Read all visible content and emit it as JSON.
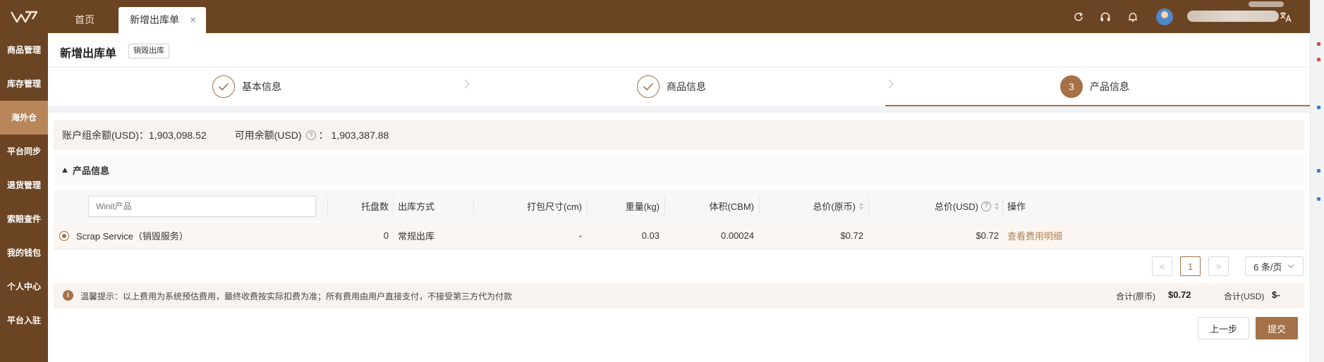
{
  "topbar": {
    "tabs": [
      {
        "label": "首页"
      },
      {
        "label": "新增出库单"
      }
    ],
    "close_glyph": "×",
    "icons": [
      "refresh-icon",
      "headset-icon",
      "bell-icon",
      "translate-icon"
    ],
    "colors": {
      "bar": "#6b4423",
      "accent": "#a47148"
    }
  },
  "sidebar": {
    "items": [
      {
        "label": "商品管理"
      },
      {
        "label": "库存管理"
      },
      {
        "label": "海外仓"
      },
      {
        "label": "平台同步"
      },
      {
        "label": "退货管理"
      },
      {
        "label": "索赔查件"
      },
      {
        "label": "我的钱包"
      },
      {
        "label": "个人中心"
      },
      {
        "label": "平台入驻"
      }
    ],
    "active_index": 2
  },
  "page": {
    "title": "新增出库单",
    "tag": "销毁出库"
  },
  "steps": [
    {
      "label": "基本信息",
      "status": "done"
    },
    {
      "label": "商品信息",
      "status": "done"
    },
    {
      "label": "产品信息",
      "status": "current",
      "number": "3"
    }
  ],
  "balance": {
    "group_label": "账户组余额(USD)：",
    "group_value": "1,903,098.52",
    "available_label": "可用余额(USD)",
    "available_sep": "：",
    "available_value": "1,903,387.88"
  },
  "section": {
    "title": "产品信息"
  },
  "table": {
    "search_placeholder": "Winit产品",
    "headers": {
      "pallets": "托盘数",
      "method": "出库方式",
      "pack_size": "打包尺寸(cm)",
      "weight": "重量(kg)",
      "volume": "体积(CBM)",
      "total_orig": "总价(原币)",
      "total_usd": "总价(USD)",
      "action": "操作"
    },
    "rows": [
      {
        "product": "Scrap Service（销毁服务）",
        "pallets": "0",
        "method": "常规出库",
        "pack_size": "-",
        "weight": "0.03",
        "volume": "0.00024",
        "total_orig": "$0.72",
        "total_usd": "$0.72",
        "action": "查看费用明细",
        "selected": true
      }
    ]
  },
  "pagination": {
    "prev": "<",
    "current_page": "1",
    "next": ">",
    "page_size": "6 条/页"
  },
  "notice": {
    "icon": "i",
    "text": "温馨提示：以上费用为系统预估费用，最终收费按实际扣费为准；所有费用由用户直接支付，不接受第三方代为付款",
    "total_orig_label": "合计(原币)",
    "total_orig_value": "$0.72",
    "total_usd_label": "合计(USD)",
    "total_usd_value": "$-"
  },
  "actions": {
    "prev_label": "上一步",
    "submit_label": "提交"
  }
}
